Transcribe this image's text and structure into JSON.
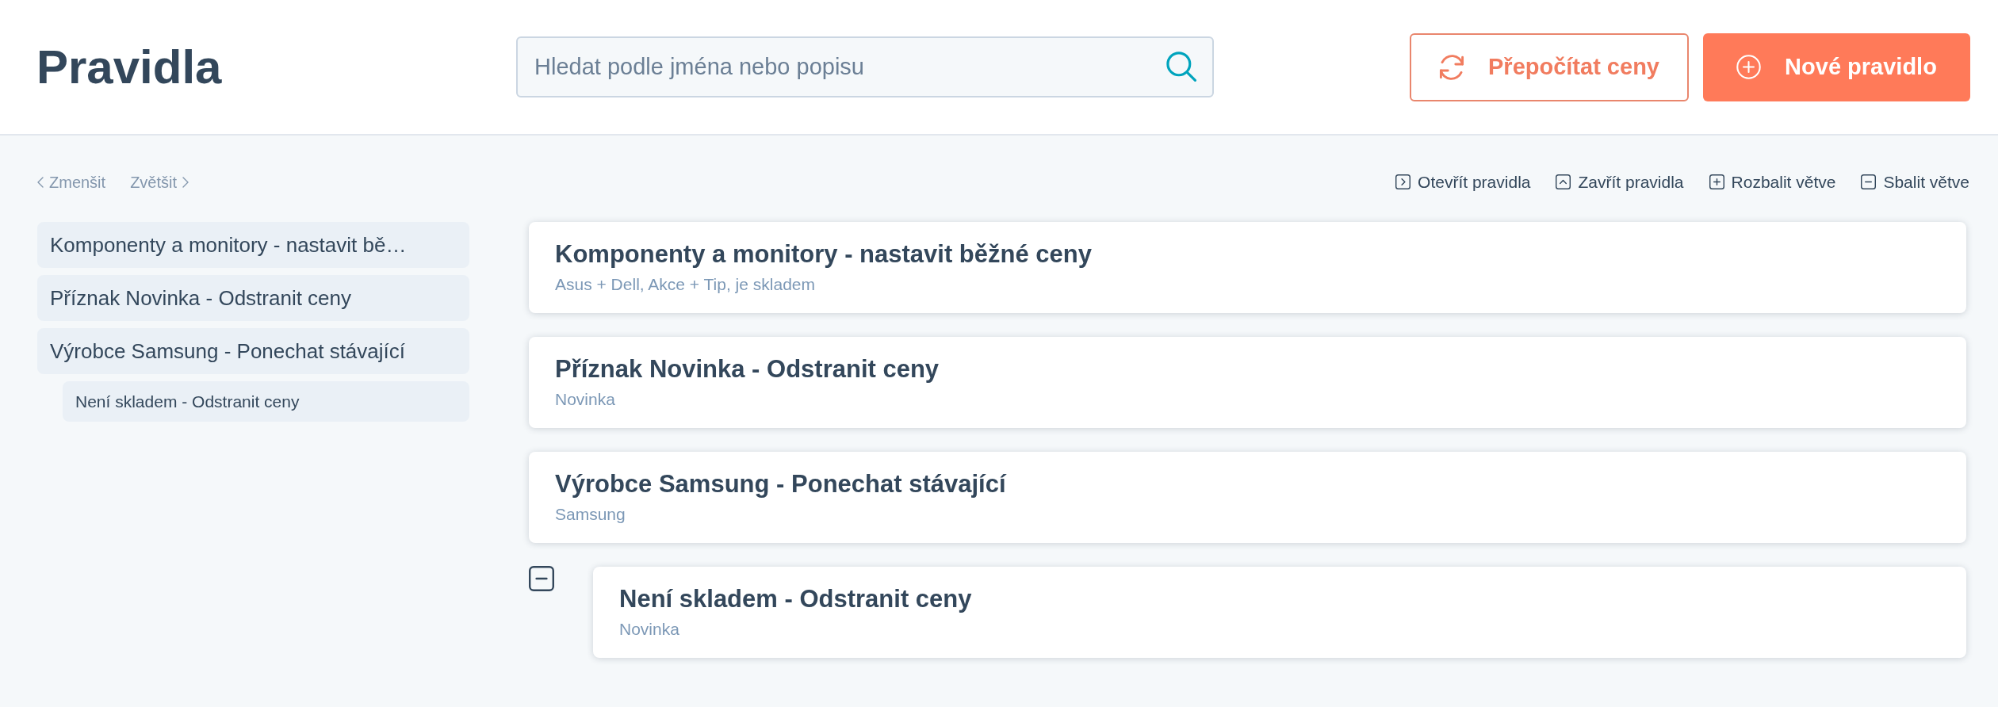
{
  "header": {
    "title": "Pravidla",
    "search": {
      "placeholder": "Hledat podle jména nebo popisu"
    },
    "buttons": [
      {
        "kind": "outline",
        "label": "Přepočítat ceny"
      },
      {
        "kind": "primary",
        "label": "Nové pravidlo"
      }
    ]
  },
  "zoom_controls": [
    {
      "kind": "prev",
      "label": "Zmenšit"
    },
    {
      "kind": "next",
      "label": "Zvětšit"
    }
  ],
  "toolbar": [
    {
      "kind": "open",
      "label": "Otevřít pravidla"
    },
    {
      "kind": "close",
      "label": "Zavřít pravidla"
    },
    {
      "kind": "expand",
      "label": "Rozbalit větve"
    },
    {
      "kind": "collapse",
      "label": "Sbalit větve"
    }
  ],
  "sidebar": {
    "items": [
      {
        "label": "Komponenty a monitory - nastavit bě…"
      },
      {
        "label": "Příznak Novinka - Odstranit ceny"
      },
      {
        "label": "Výrobce Samsung - Ponechat stávající",
        "children": [
          {
            "label": "Není skladem - Odstranit ceny"
          }
        ]
      }
    ]
  },
  "rules": [
    {
      "title": "Komponenty a monitory - nastavit běžné ceny",
      "subtitle": "Asus + Dell, Akce + Tip, je skladem"
    },
    {
      "title": "Příznak Novinka - Odstranit ceny",
      "subtitle": "Novinka"
    },
    {
      "title": "Výrobce Samsung - Ponechat stávající",
      "subtitle": "Samsung",
      "expanded": true,
      "children": [
        {
          "title": "Není skladem - Odstranit ceny",
          "subtitle": "Novinka"
        }
      ]
    }
  ]
}
